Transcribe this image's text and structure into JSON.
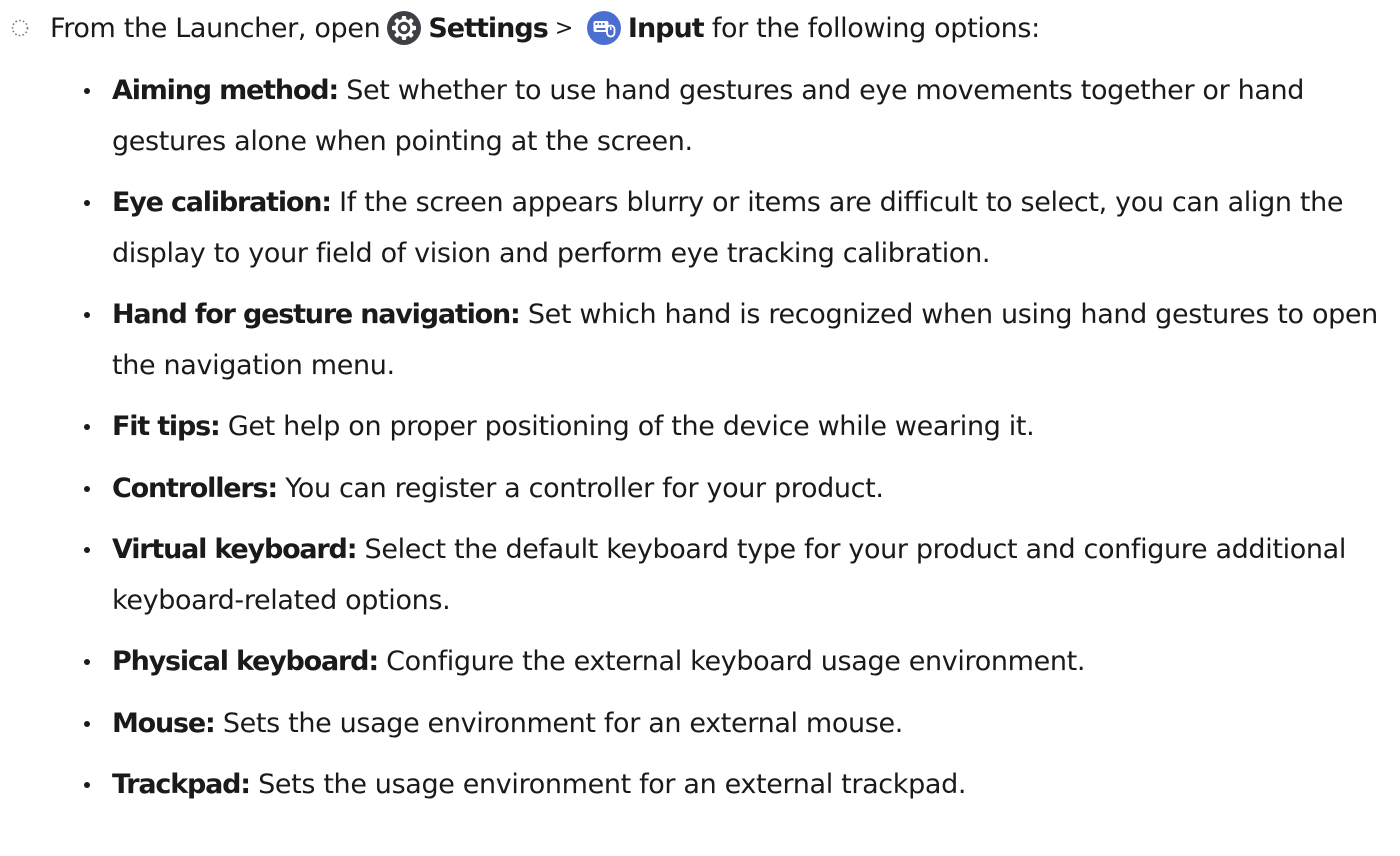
{
  "step": {
    "text_before": "From the Launcher, open",
    "settings_label": "Settings",
    "separator": ">",
    "input_label": "Input",
    "text_after": "for the following options:",
    "settings_icon": "settings-gear-icon",
    "input_icon": "keyboard-input-icon",
    "accent_color": "#4a6fd1"
  },
  "options": [
    {
      "term": "Aiming method",
      "description": "Set whether to use hand gestures and eye movements together or hand gestures alone when pointing at the screen."
    },
    {
      "term": "Eye calibration",
      "description": "If the screen appears blurry or items are difficult to select, you can align the display to your field of vision and perform eye tracking calibration."
    },
    {
      "term": "Hand for gesture navigation",
      "description": "Set which hand is recognized when using hand gestures to open the navigation menu."
    },
    {
      "term": "Fit tips",
      "description": "Get help on proper positioning of the device while wearing it."
    },
    {
      "term": "Controllers",
      "description": "You can register a controller for your product."
    },
    {
      "term": "Virtual keyboard",
      "description": "Select the default keyboard type for your product and configure additional keyboard-related options."
    },
    {
      "term": "Physical keyboard",
      "description": "Configure the external keyboard usage environment."
    },
    {
      "term": "Mouse",
      "description": "Sets the usage environment for an external mouse."
    },
    {
      "term": "Trackpad",
      "description": "Sets the usage environment for an external trackpad."
    }
  ]
}
